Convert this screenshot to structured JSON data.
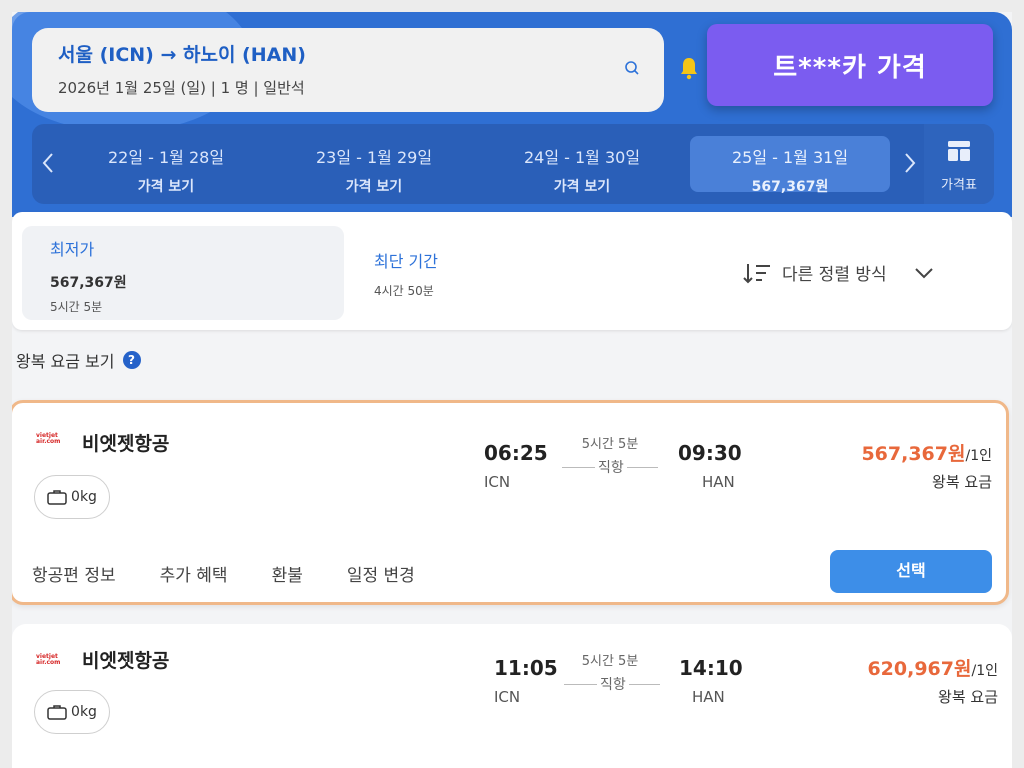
{
  "search": {
    "route": "서울 (ICN) → 하노이 (HAN)",
    "details": "2026년 1월 25일 (일)  |  1 명  |  일반석"
  },
  "promo": {
    "label": "트***카 가격"
  },
  "date_tabs": [
    {
      "dates": "22일 - 1월 28일",
      "price": "가격 보기"
    },
    {
      "dates": "23일 - 1월 29일",
      "price": "가격 보기"
    },
    {
      "dates": "24일 - 1월 30일",
      "price": "가격 보기"
    },
    {
      "dates": "25일 - 1월 31일",
      "price": "567,367원"
    }
  ],
  "price_table": {
    "label": "가격표"
  },
  "sort": {
    "cheapest": {
      "label": "최저가",
      "price": "567,367원",
      "duration": "5시간 5분"
    },
    "shortest": {
      "label": "최단 기간",
      "duration": "4시간 50분"
    },
    "other": {
      "label": "다른 정렬 방식"
    }
  },
  "roundtrip_label": "왕복 요금 보기",
  "flights": [
    {
      "airline": "비엣젯항공",
      "logo_text": "vietjet air.com",
      "baggage": "0kg",
      "depart_time": "06:25",
      "depart_code": "ICN",
      "duration": "5시간 5분",
      "stops": "직항",
      "arrive_time": "09:30",
      "arrive_code": "HAN",
      "price": "567,367원",
      "per": "/1인",
      "price_note": "왕복 요금"
    },
    {
      "airline": "비엣젯항공",
      "logo_text": "vietjet air.com",
      "baggage": "0kg",
      "depart_time": "11:05",
      "depart_code": "ICN",
      "duration": "5시간 5분",
      "stops": "직항",
      "arrive_time": "14:10",
      "arrive_code": "HAN",
      "price": "620,967원",
      "per": "/1인",
      "price_note": "왕복 요금"
    }
  ],
  "card_links": [
    "항공편 정보",
    "추가 혜택",
    "환불",
    "일정 변경"
  ],
  "select_label": "선택",
  "colors": {
    "header": "#2f6fd3",
    "promo": "#7b5cf0",
    "price": "#e8683b",
    "select": "#3d8ee8",
    "highlight_border": "#f0b889"
  }
}
